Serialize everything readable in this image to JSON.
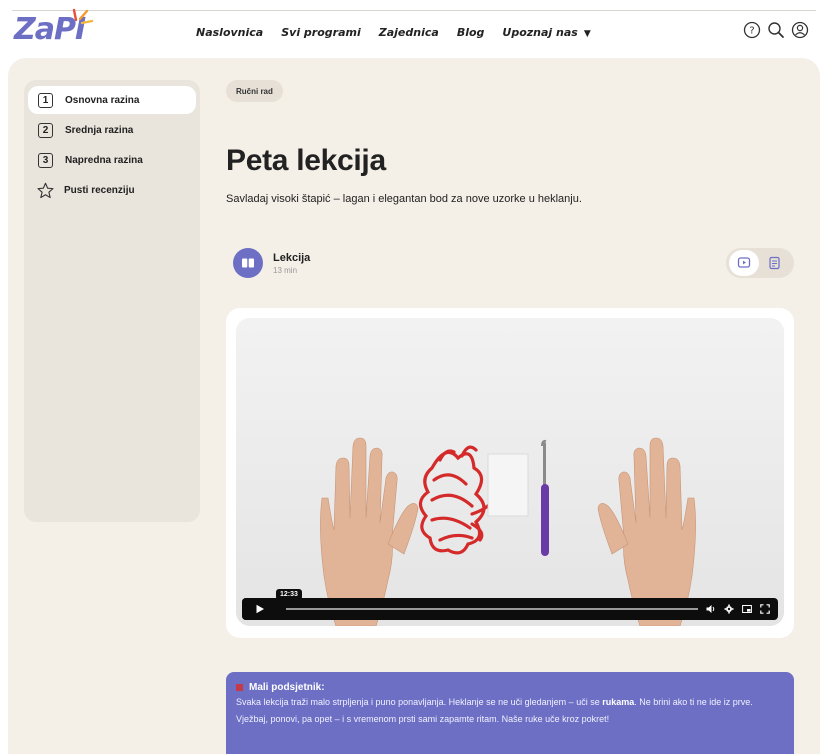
{
  "header": {
    "logo_text": "ZaPI",
    "nav": [
      {
        "label": "Naslovnica"
      },
      {
        "label": "Svi programi"
      },
      {
        "label": "Zajednica"
      },
      {
        "label": "Blog"
      },
      {
        "label": "Upoznaj nas",
        "dropdown": true
      }
    ],
    "icons": [
      "help-icon",
      "search-icon",
      "user-icon"
    ],
    "brand_color": "#6c6fc4"
  },
  "sidebar": {
    "items": [
      {
        "number": "1",
        "label": "Osnovna razina",
        "active": true
      },
      {
        "number": "2",
        "label": "Srednja razina",
        "active": false
      },
      {
        "number": "3",
        "label": "Napredna razina",
        "active": false
      },
      {
        "icon": "star-icon",
        "label": "Pusti recenziju",
        "active": false
      }
    ]
  },
  "content": {
    "tag": "Ručni rad",
    "title": "Peta lekcija",
    "subtitle": "Savladaj visoki štapić – lagan i elegantan bod za nove uzorke u heklanju.",
    "lesson": {
      "name": "Lekcija",
      "duration": "13 min"
    },
    "view_toggle": [
      "video-icon",
      "document-icon"
    ]
  },
  "video": {
    "time": "12:33",
    "progress": 0.0
  },
  "note": {
    "heading": "Mali podsjetnik:",
    "text_before": "Svaka lekcija traži malo strpljenja i puno ponavljanja. Heklanje se ne uči gledanjem – uči se ",
    "text_bold": "rukama",
    "text_after": ". Ne brini ako ti ne ide iz prve. Vježbaj, ponovi, pa opet – i s vremenom prsti sami zapamte ritam. Naše ruke uče kroz pokret!"
  }
}
